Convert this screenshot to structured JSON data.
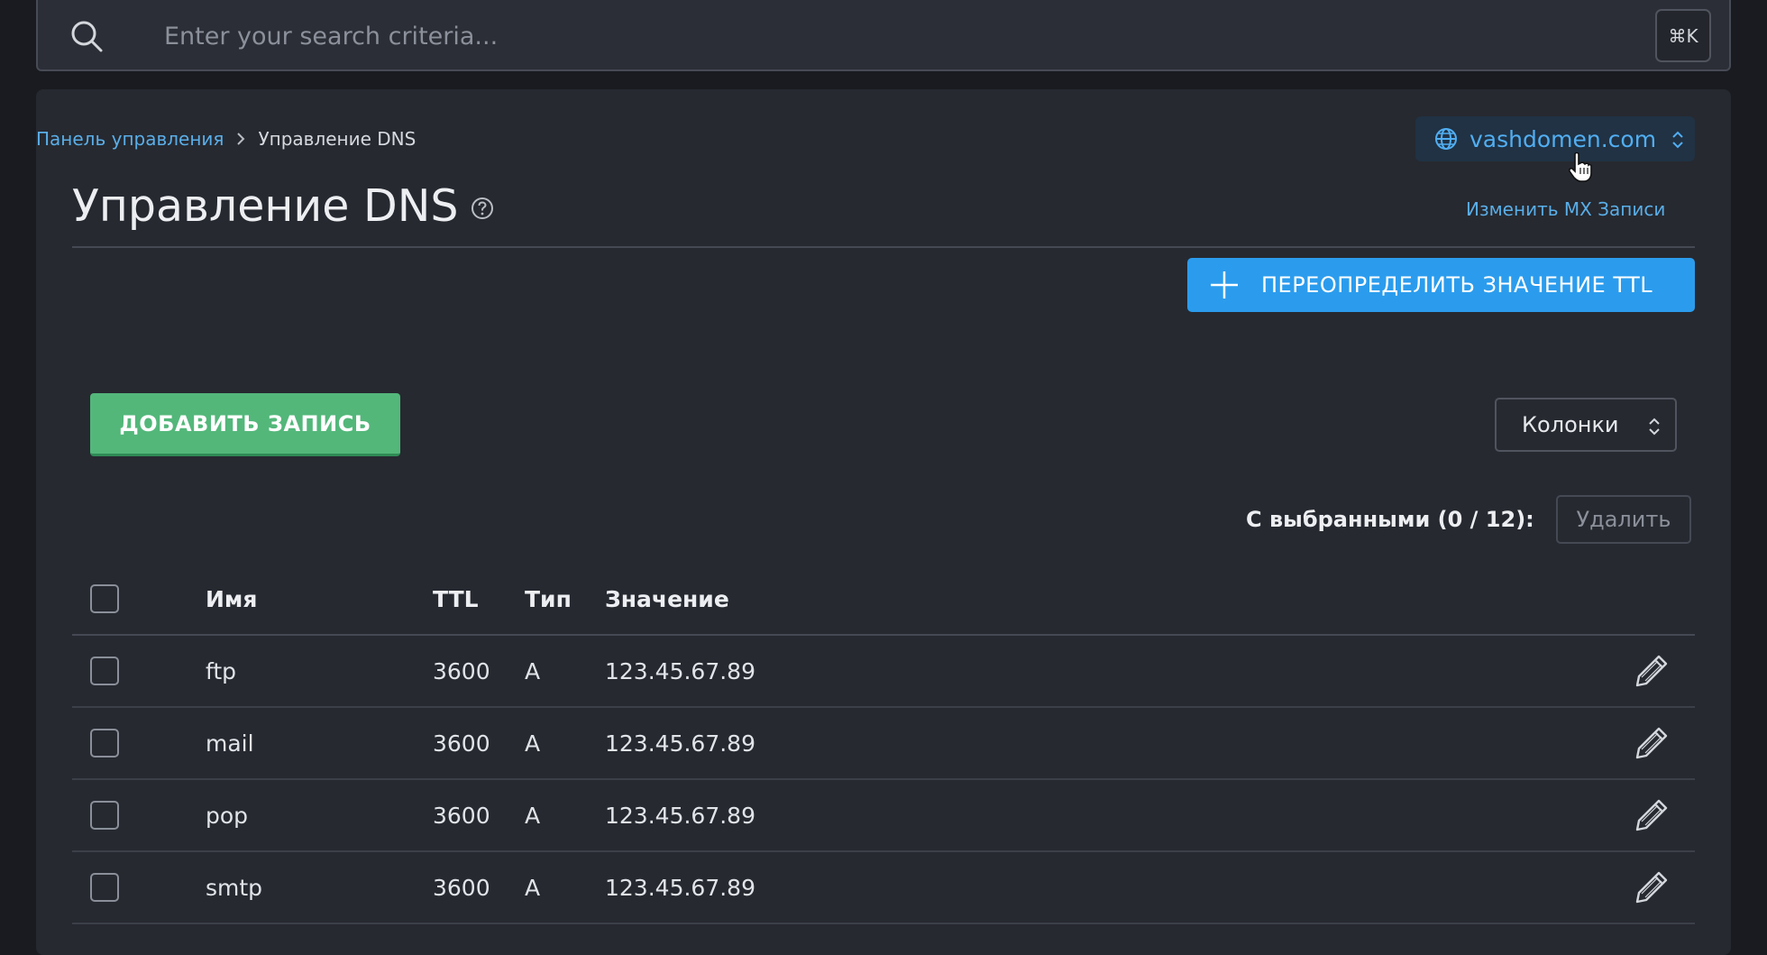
{
  "search": {
    "placeholder": "Enter your search criteria...",
    "shortcut": "⌘K"
  },
  "breadcrumb": {
    "home": "Панель управления",
    "current": "Управление DNS"
  },
  "domain_selector": {
    "value": "vashdomen.com"
  },
  "page": {
    "title": "Управление DNS",
    "mx_link": "Изменить MX Записи",
    "ttl_button": "ПЕРЕОПРЕДЕЛИТЬ ЗНАЧЕНИЕ TTL",
    "add_button": "ДОБАВИТЬ ЗАПИСЬ",
    "columns_select": "Колонки",
    "bulk_label": "С выбранными (0 / 12):",
    "delete_button": "Удалить"
  },
  "table": {
    "headers": {
      "name": "Имя",
      "ttl": "TTL",
      "type": "Тип",
      "value": "Значение"
    },
    "rows": [
      {
        "name": "ftp",
        "ttl": "3600",
        "type": "A",
        "value": "123.45.67.89"
      },
      {
        "name": "mail",
        "ttl": "3600",
        "type": "A",
        "value": "123.45.67.89"
      },
      {
        "name": "pop",
        "ttl": "3600",
        "type": "A",
        "value": "123.45.67.89"
      },
      {
        "name": "smtp",
        "ttl": "3600",
        "type": "A",
        "value": "123.45.67.89"
      }
    ]
  },
  "colors": {
    "background": "#191b20",
    "panel": "#262930",
    "accent_blue": "#2b9ced",
    "link_blue": "#5aaee8",
    "accent_green": "#53b77a"
  },
  "icons": [
    "search-icon",
    "chevron-right-icon",
    "globe-icon",
    "chevron-updown-icon",
    "hand-pointer-icon",
    "help-icon",
    "plus-icon",
    "pencil-icon"
  ]
}
